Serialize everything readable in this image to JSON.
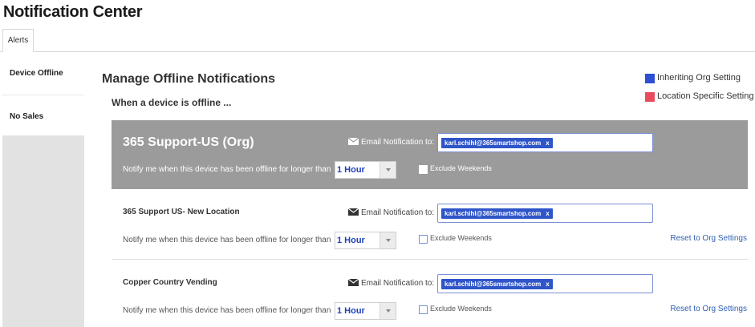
{
  "header": {
    "title": "Notification Center"
  },
  "tabs": [
    {
      "label": "Alerts"
    }
  ],
  "sidebar": {
    "items": [
      {
        "label": "Device Offline"
      },
      {
        "label": "No Sales"
      }
    ]
  },
  "main": {
    "title": "Manage Offline Notifications",
    "subtitle": "When a device is offline ..."
  },
  "legend": {
    "items": [
      {
        "label": "Inheriting Org Setting",
        "color": "#2d4fd2"
      },
      {
        "label": "Location Specific Setting",
        "color": "#e94b5f"
      }
    ]
  },
  "email_label": "Email Notification to:",
  "notify_label": "Notify me when this device has been offline for longer than",
  "exclude_label": "Exclude Weekends",
  "rows": [
    {
      "name": "365 Support-US (Org)",
      "email": "karl.schihl@365smartshop.com",
      "chip_remove": "x",
      "duration": "1 Hour",
      "reset_label": ""
    },
    {
      "name": "365 Support US- New Location",
      "email": "karl.schihl@365smartshop.com",
      "chip_remove": "x",
      "duration": "1 Hour",
      "reset_label": "Reset to Org Settings"
    },
    {
      "name": "Copper Country Vending",
      "email": "karl.schihl@365smartshop.com",
      "chip_remove": "x",
      "duration": "1 Hour",
      "reset_label": "Reset to Org Settings"
    }
  ]
}
